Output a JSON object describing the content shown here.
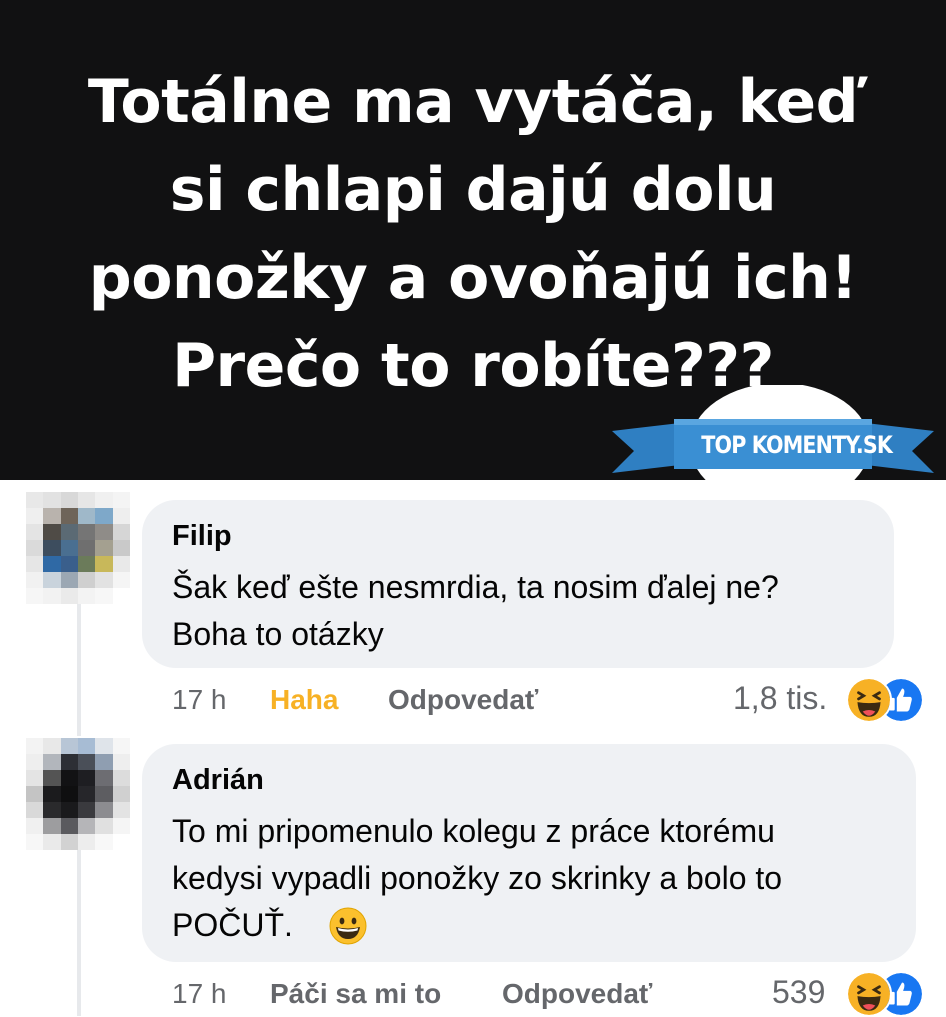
{
  "header": {
    "lines": [
      "Totálne ma vytáča, keď",
      "si chlapi dajú dolu",
      "ponožky a ovoňajú ich!",
      "Prečo to robíte???"
    ],
    "background": "#111112"
  },
  "watermark": {
    "label": "TOP KOMENTY.SK",
    "ribbon_color": "#3a8fd3"
  },
  "comments": [
    {
      "author": "Filip",
      "lines": [
        "Šak keď ešte nesmrdia, ta nosim ďalej ne?",
        "Boha to otázky"
      ],
      "time": "17 h",
      "reaction": "Haha",
      "reply": "Odpovedať",
      "count": "1,8 tis.",
      "reaction_icons": [
        "haha-icon",
        "like-icon"
      ]
    },
    {
      "author": "Adrián",
      "lines": [
        "To mi pripomenulo kolegu z práce ktorému",
        "kedysi vypadli ponožky zo skrinky a bolo to",
        "POČUŤ."
      ],
      "time": "17 h",
      "reaction": "Páči sa mi to",
      "reply": "Odpovedať",
      "count": "539",
      "reaction_icons": [
        "haha-icon",
        "like-icon"
      ]
    }
  ],
  "colors": {
    "bubble": "#eff1f4",
    "haha_label": "#f7b125",
    "like_blue": "#1877f2",
    "meta_gray": "#65676b"
  }
}
